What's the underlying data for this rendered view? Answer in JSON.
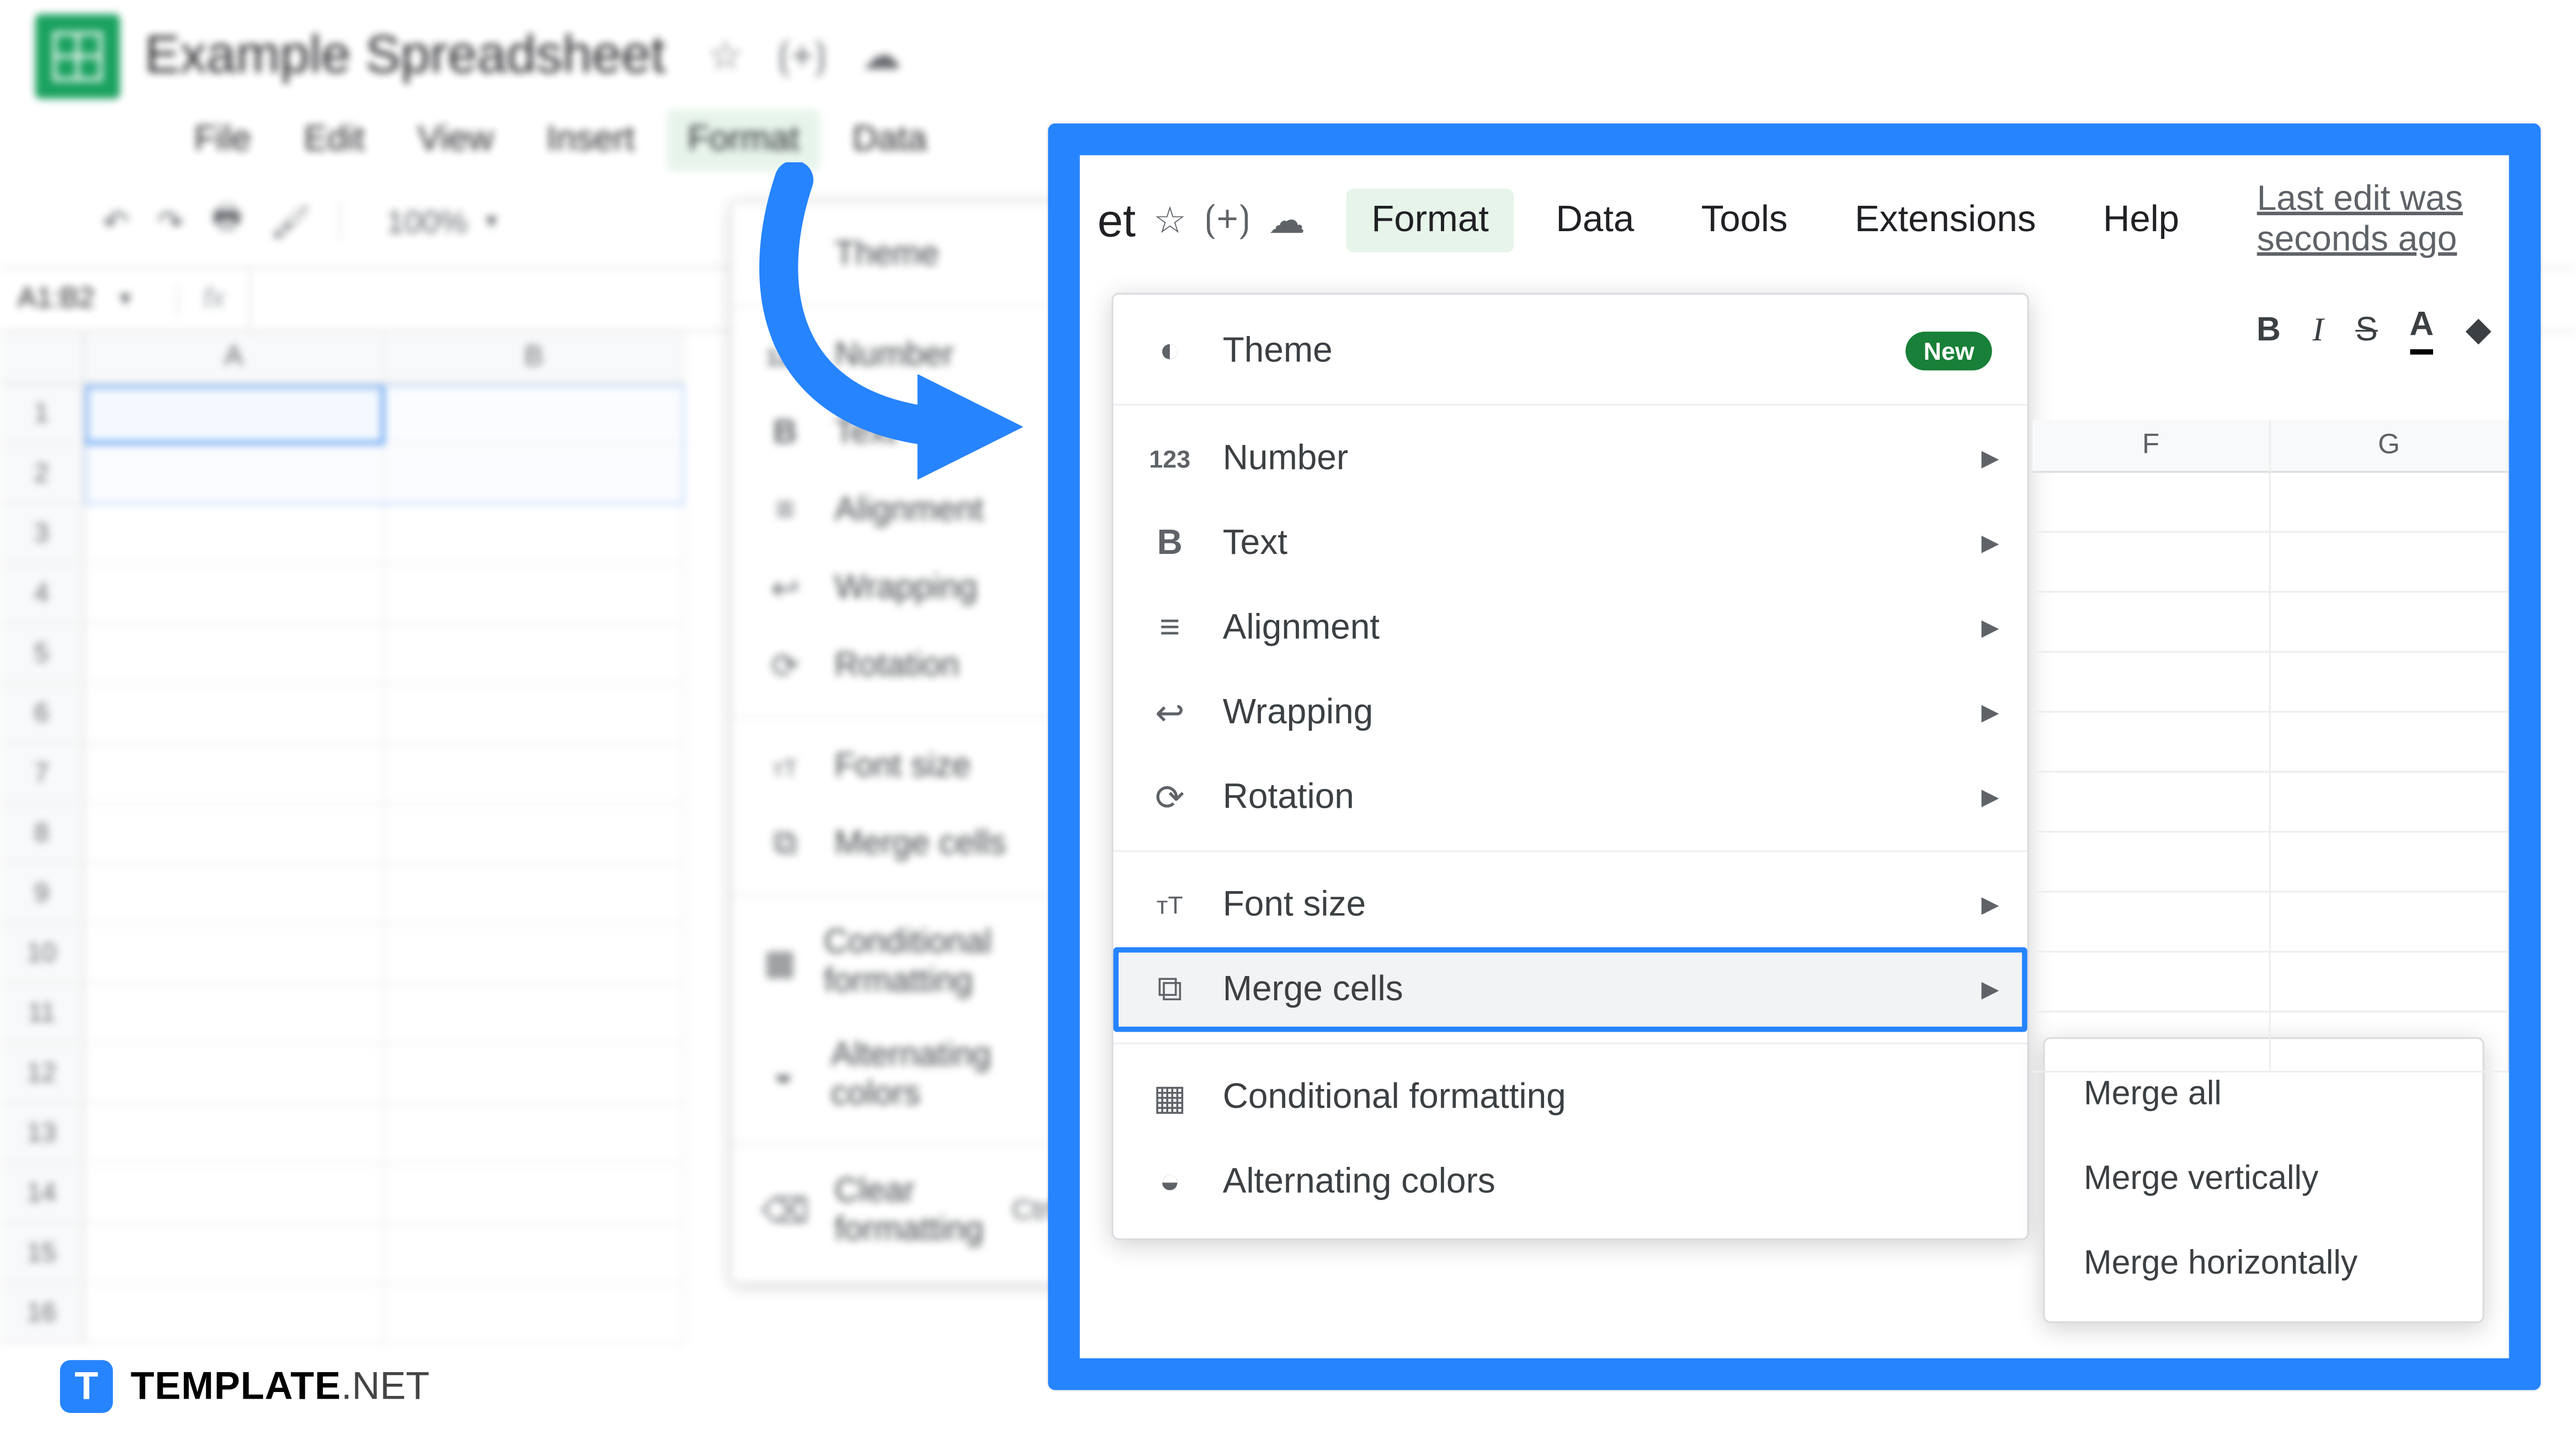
{
  "app": {
    "title": "Example Spreadsheet",
    "star_icon": "star-icon",
    "move_icon": "move-icon",
    "cloud_icon": "cloud-icon"
  },
  "menubar": {
    "items": [
      "File",
      "Edit",
      "View",
      "Insert",
      "Format",
      "Data",
      "Tools",
      "Extensions",
      "Help"
    ],
    "last_edit": "Last edit was seconds ago",
    "active": "Format"
  },
  "toolbar": {
    "zoom": "100%"
  },
  "namebox": {
    "range": "A1:B2",
    "fx": "fx"
  },
  "columns": [
    "A",
    "B"
  ],
  "rows": [
    "1",
    "2",
    "3",
    "4",
    "5",
    "6",
    "7",
    "8",
    "9",
    "10",
    "11",
    "12",
    "13",
    "14",
    "15",
    "16"
  ],
  "format_menu": {
    "items": [
      {
        "icon": "theme-icon",
        "label": "Theme",
        "badge": "New"
      },
      {
        "sep": true
      },
      {
        "icon": "number-icon",
        "label": "Number",
        "sub": true,
        "glyph": "123"
      },
      {
        "icon": "text-icon",
        "label": "Text",
        "sub": true,
        "glyph": "B"
      },
      {
        "icon": "alignment-icon",
        "label": "Alignment",
        "sub": true
      },
      {
        "icon": "wrapping-icon",
        "label": "Wrapping",
        "sub": true
      },
      {
        "icon": "rotation-icon",
        "label": "Rotation",
        "sub": true
      },
      {
        "sep": true
      },
      {
        "icon": "fontsize-icon",
        "label": "Font size",
        "sub": true,
        "glyph": "тT"
      },
      {
        "icon": "merge-icon",
        "label": "Merge cells",
        "sub": true,
        "hl": true
      },
      {
        "sep": true
      },
      {
        "icon": "conditional-icon",
        "label": "Conditional formatting"
      },
      {
        "icon": "altcolors-icon",
        "label": "Alternating colors"
      },
      {
        "sep": true
      },
      {
        "icon": "clear-icon",
        "label": "Clear formatting",
        "shortcut": "Ctrl+\\"
      }
    ]
  },
  "merge_submenu": {
    "items": [
      "Merge all",
      "Merge vertically",
      "Merge horizontally"
    ]
  },
  "overlay_columns": [
    "F",
    "G"
  ],
  "overlay_toolbar": {
    "bold": "B",
    "italic": "I",
    "strike": "S",
    "textcolor": "A"
  },
  "watermark": {
    "brand": "TEMPLATE",
    "tld": ".NET",
    "icon": "T"
  }
}
